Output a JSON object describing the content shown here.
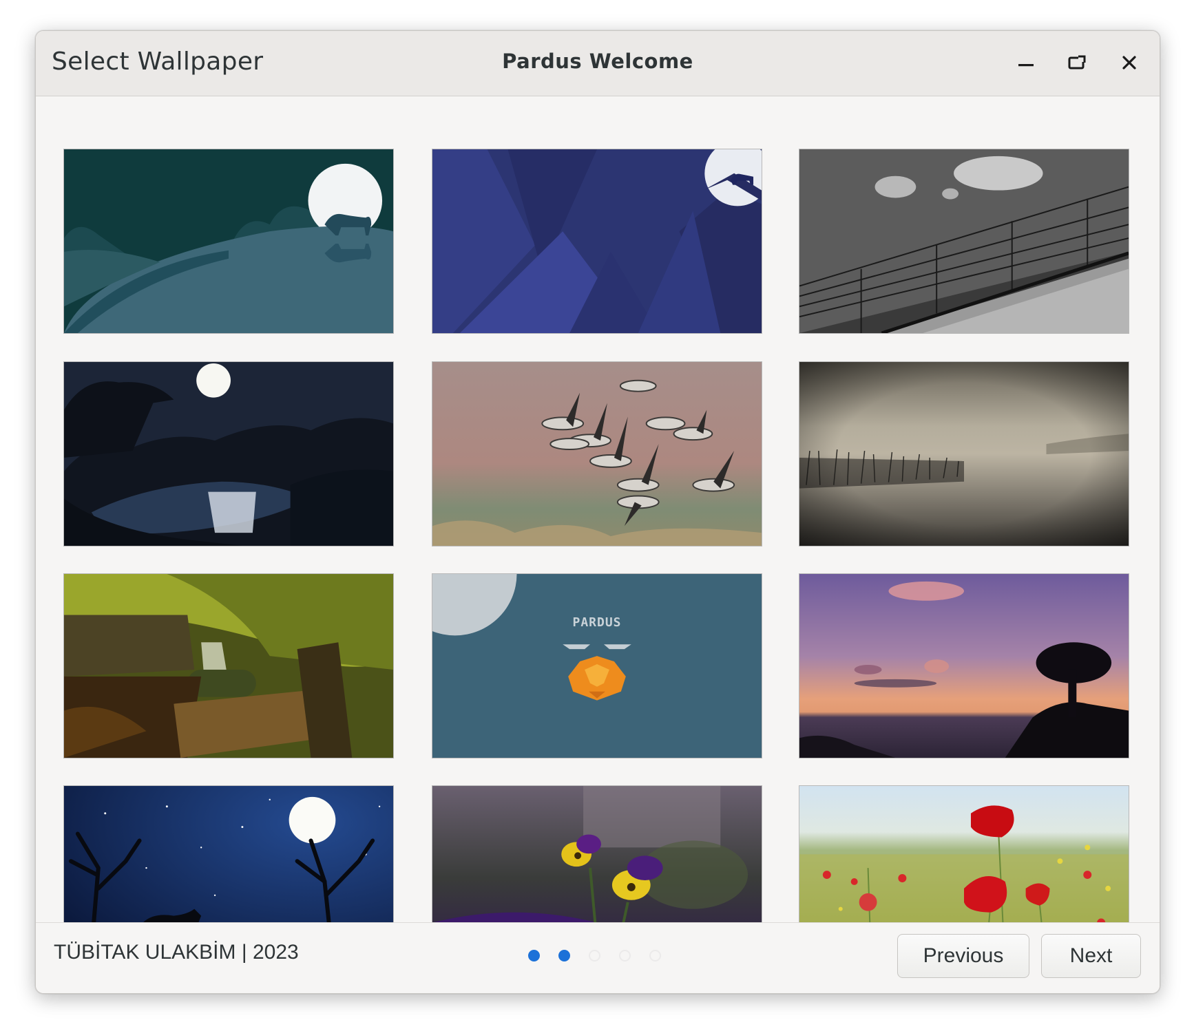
{
  "window": {
    "page_title": "Select Wallpaper",
    "app_title": "Pardus Welcome",
    "controls": {
      "minimize_icon": "minimize-icon",
      "maximize_icon": "maximize-icon",
      "close_icon": "close-icon"
    }
  },
  "wallpapers": [
    {
      "name": "panther-moon-hills"
    },
    {
      "name": "mountain-panther-blue"
    },
    {
      "name": "concrete-railing-bw"
    },
    {
      "name": "moonlit-lake-night"
    },
    {
      "name": "flying-geese"
    },
    {
      "name": "misty-lake-reeds"
    },
    {
      "name": "forest-waterfall-bridge"
    },
    {
      "name": "pardus-logo"
    },
    {
      "name": "sunset-sea-tree"
    },
    {
      "name": "starry-night-panther"
    },
    {
      "name": "purple-pansy-flowers"
    },
    {
      "name": "poppy-field"
    }
  ],
  "wallpaper_logo_text": "PARDUS",
  "footer": {
    "copyright": "TÜBİTAK ULAKBİM | 2023",
    "pagination": {
      "total": 5,
      "filled": 2
    },
    "previous_label": "Previous",
    "next_label": "Next"
  },
  "colors": {
    "accent": "#1c71d8",
    "window_bg": "#f6f5f4",
    "titlebar_bg": "#ebe9e7"
  }
}
